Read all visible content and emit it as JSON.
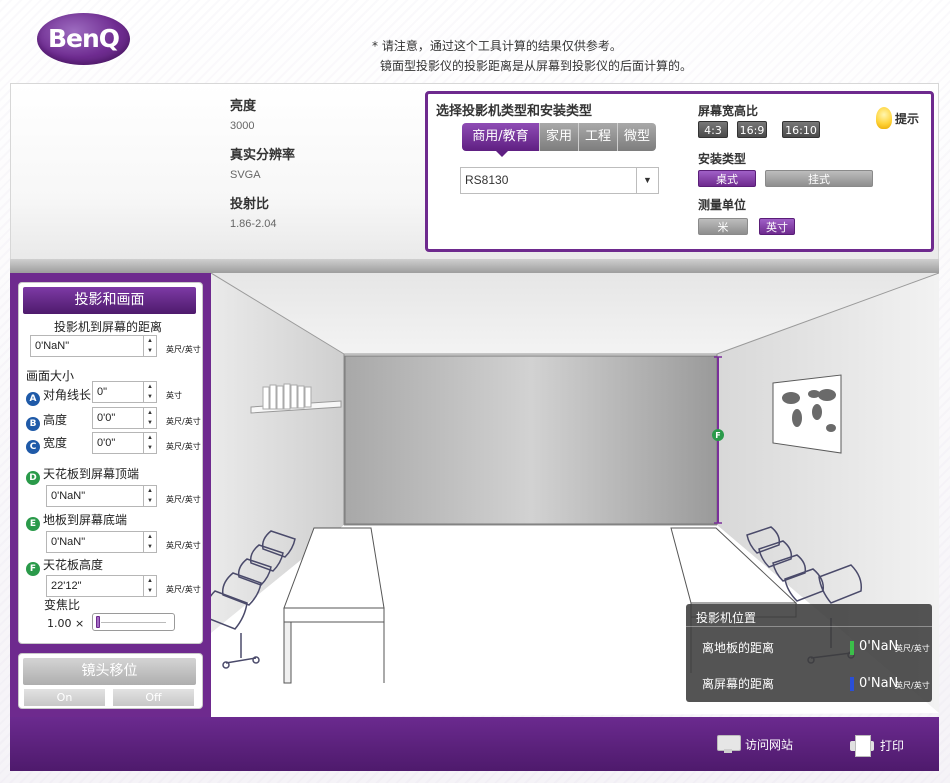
{
  "header": {
    "logo_text": "BenQ",
    "notice_line1": "* 请注意，通过这个工具计算的结果仅供参考。",
    "notice_line2": "镜面型投影仪的投影距离是从屏幕到投影仪的后面计算的。"
  },
  "specs": {
    "brightness_label": "亮度",
    "brightness_value": "3000",
    "resolution_label": "真实分辨率",
    "resolution_value": "SVGA",
    "throw_ratio_label": "投射比",
    "throw_ratio_value": "1.86-2.04"
  },
  "selector": {
    "title": "选择投影机类型和安装类型",
    "tabs": [
      "商用/教育",
      "家用",
      "工程",
      "微型"
    ],
    "active_tab": "商用/教育",
    "model_value": "RS8130",
    "aspect_label": "屏幕宽高比",
    "aspect_options": [
      "4:3",
      "16:9",
      "16:10"
    ],
    "install_label": "安装类型",
    "install_options": [
      "桌式",
      "挂式"
    ],
    "install_selected": "桌式",
    "unit_label": "测量单位",
    "unit_options": [
      "米",
      "英寸"
    ],
    "unit_selected": "英寸",
    "hint_label": "提示"
  },
  "left_panel": {
    "title": "投影和画面",
    "distance_label": "投影机到屏幕的距离",
    "distance_value": "0'NaN\"",
    "unit_ftin": "英尺/英寸",
    "unit_in": "英寸",
    "screen_size_label": "画面大小",
    "diagonal_badge": "A",
    "diagonal_label": "对角线长",
    "diagonal_value": "0\"",
    "height_badge": "B",
    "height_label": "高度",
    "height_value": "0'0\"",
    "width_badge": "C",
    "width_label": "宽度",
    "width_value": "0'0\"",
    "ceiling_top_badge": "D",
    "ceiling_top_label": "天花板到屏幕顶端",
    "ceiling_top_value": "0'NaN\"",
    "floor_bottom_badge": "E",
    "floor_bottom_label": "地板到屏幕底端",
    "floor_bottom_value": "0'NaN\"",
    "ceiling_height_badge": "F",
    "ceiling_height_label": "天花板高度",
    "ceiling_height_value": "22'12\"",
    "zoom_label": "变焦比",
    "zoom_value": "1.00",
    "zoom_suffix": "×",
    "lens_shift_title": "镜头移位",
    "lens_on": "On",
    "lens_off": "Off"
  },
  "scene": {
    "screen_marker": "F"
  },
  "position_panel": {
    "title": "投影机位置",
    "floor_label": "离地板的距离",
    "floor_value": "0'NaN",
    "screen_label": "离屏幕的距离",
    "screen_value": "0'NaN",
    "unit": "英尺/英寸",
    "floor_mark_color": "#3bbf4a",
    "screen_mark_color": "#2a4fd8"
  },
  "footer": {
    "visit_label": "访问网站",
    "print_label": "打印"
  },
  "colors": {
    "brand_purple": "#6e2a8e",
    "accent_green": "#2a9a4a",
    "accent_blue": "#1f5aa8"
  }
}
